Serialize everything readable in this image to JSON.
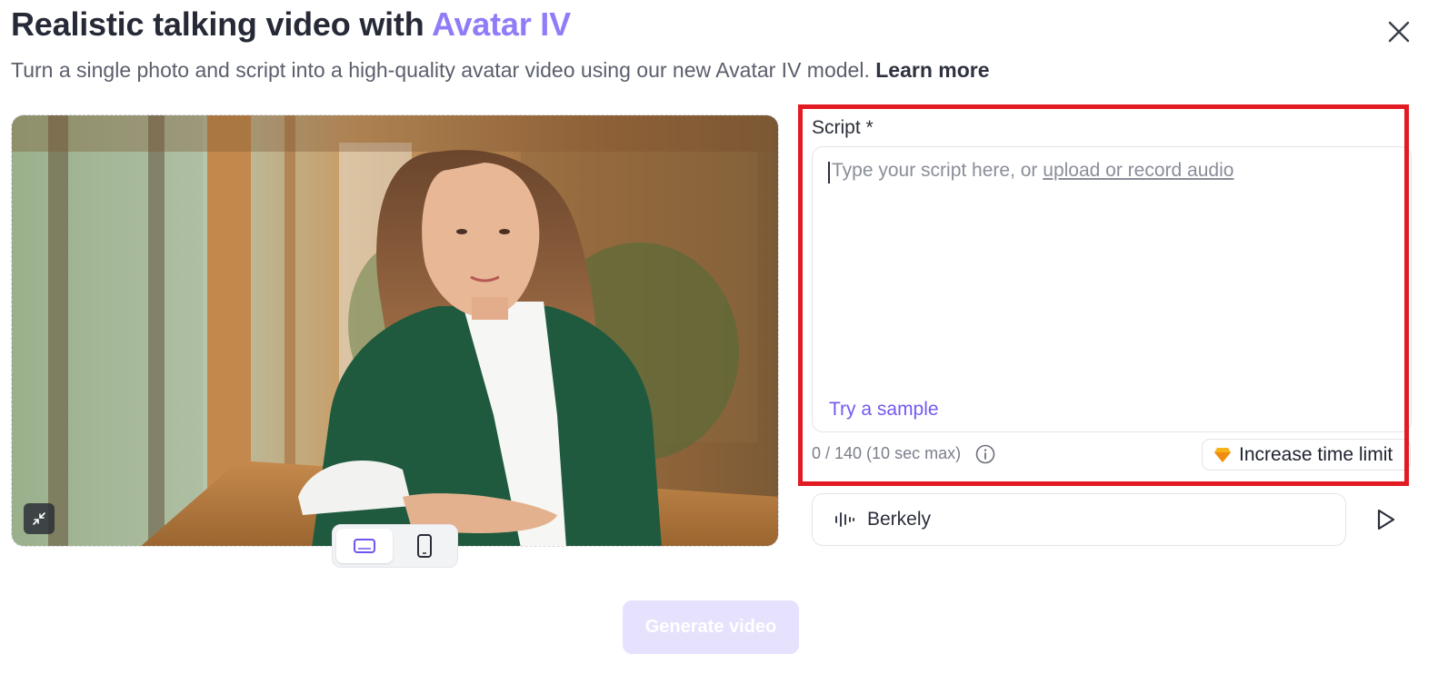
{
  "header": {
    "title_prefix": "Realistic talking video with ",
    "title_accent": "Avatar IV",
    "subtitle": "Turn a single photo and script into a high-quality avatar video using our new Avatar IV model. ",
    "learn_more": "Learn more"
  },
  "preview": {
    "collapse_icon": "collapse-arrows-icon",
    "ratio_options": [
      {
        "icon": "landscape-icon",
        "selected": true
      },
      {
        "icon": "portrait-phone-icon",
        "selected": false
      }
    ]
  },
  "script": {
    "label": "Script *",
    "placeholder_prefix": "Type your script here, or ",
    "placeholder_link": "upload or record audio",
    "try_sample": "Try a sample",
    "counter": "0 / 140 (10 sec max)",
    "increase_limit": "Increase time limit"
  },
  "voice": {
    "name": "Berkely",
    "icon": "audio-waveform-icon",
    "play_icon": "play-icon"
  },
  "actions": {
    "generate": "Generate video"
  },
  "colors": {
    "accent": "#8f7cf8",
    "link_purple": "#7559f0",
    "highlight_red": "#e21b23",
    "generate_disabled": "#e6e1fd"
  }
}
